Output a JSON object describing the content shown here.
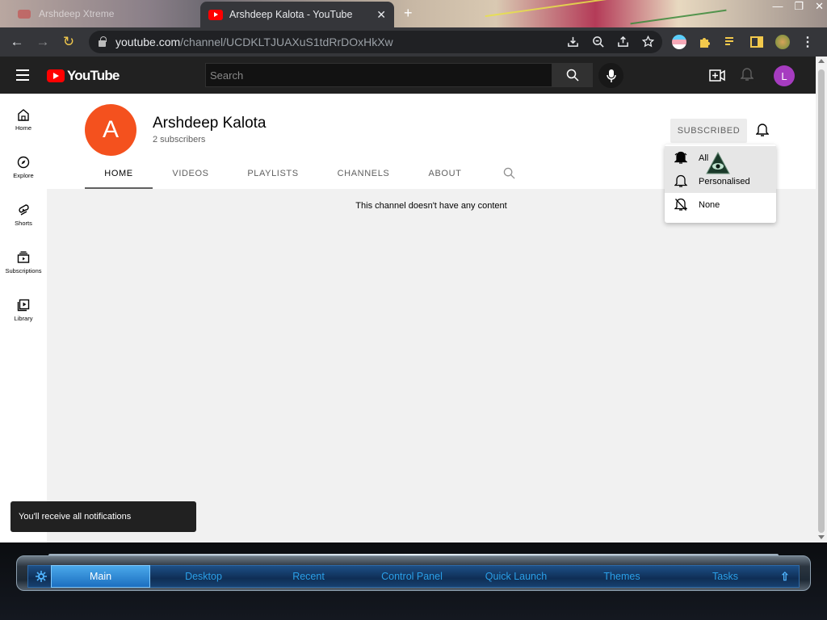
{
  "browser": {
    "inactive_tab_title": "Arshdeep Xtreme",
    "active_tab_title": "Arshdeep Kalota - YouTube",
    "close_glyph": "✕",
    "new_tab_glyph": "+",
    "url_host": "youtube.com",
    "url_path": "/channel/UCDKLTJUAXuS1tdRrDOxHkXw"
  },
  "youtube": {
    "logo_text": "YouTube",
    "search_placeholder": "Search",
    "user_initial": "L"
  },
  "sidebar": {
    "items": [
      {
        "label": "Home",
        "icon": "home-icon"
      },
      {
        "label": "Explore",
        "icon": "compass-icon"
      },
      {
        "label": "Shorts",
        "icon": "shorts-icon"
      },
      {
        "label": "Subscriptions",
        "icon": "subscriptions-icon"
      },
      {
        "label": "Library",
        "icon": "library-icon"
      }
    ]
  },
  "channel": {
    "avatar_letter": "A",
    "name": "Arshdeep Kalota",
    "subscribers": "2 subscribers",
    "subscribe_label": "SUBSCRIBED",
    "tabs": [
      "HOME",
      "VIDEOS",
      "PLAYLISTS",
      "CHANNELS",
      "ABOUT"
    ],
    "active_tab": "HOME",
    "empty_message": "This channel doesn't have any content"
  },
  "notification_menu": {
    "options": [
      {
        "label": "All",
        "icon": "bell-filled-icon",
        "selected": true
      },
      {
        "label": "Personalised",
        "icon": "bell-outline-icon",
        "selected": false
      },
      {
        "label": "None",
        "icon": "bell-off-icon",
        "selected": false
      }
    ]
  },
  "toast": {
    "message": "You'll receive all notifications"
  },
  "dock": {
    "items": [
      "Main",
      "Desktop",
      "Recent",
      "Control Panel",
      "Quick Launch",
      "Themes",
      "Tasks"
    ],
    "active_item": "Main"
  },
  "colors": {
    "youtube_red": "#ff0000",
    "channel_avatar": "#f4511e",
    "user_avatar": "#a63cc0",
    "dock_accent": "#2a9fe8"
  }
}
